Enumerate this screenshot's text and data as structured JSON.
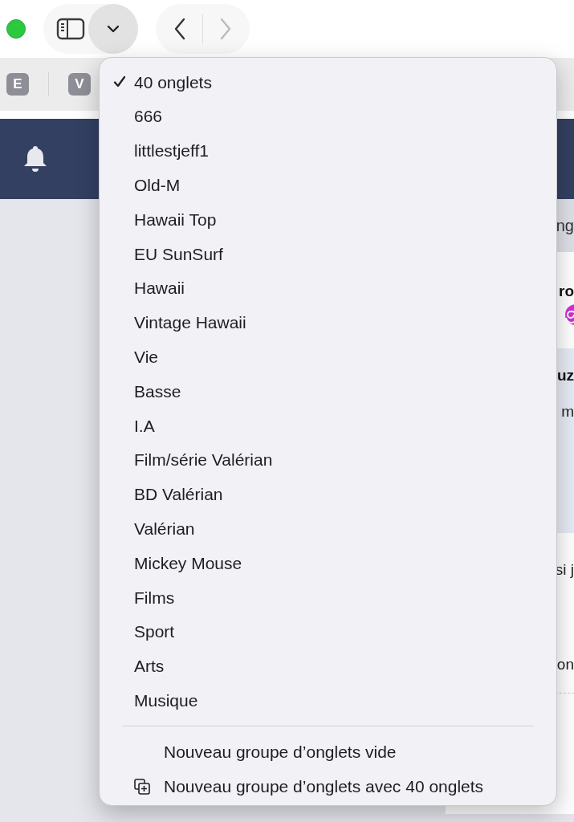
{
  "toolbar": {
    "sidebar_menu_open": true,
    "back_enabled": true,
    "forward_enabled": false
  },
  "favorites": [
    {
      "label": "E"
    },
    {
      "label": "V"
    }
  ],
  "background_fragments": [
    {
      "kind": "heading",
      "text": "ng"
    },
    {
      "kind": "bold",
      "text": "ro"
    },
    {
      "kind": "badge"
    },
    {
      "kind": "bold",
      "text": "uz"
    },
    {
      "kind": "plain",
      "text": "m"
    },
    {
      "kind": "plain",
      "text": "si j"
    },
    {
      "kind": "plain",
      "text": "on"
    }
  ],
  "menu": {
    "groups": [
      {
        "label": "40 onglets",
        "selected": true
      },
      {
        "label": "666",
        "selected": false
      },
      {
        "label": "littlestjeff1",
        "selected": false
      },
      {
        "label": "Old-M",
        "selected": false
      },
      {
        "label": "Hawaii Top",
        "selected": false
      },
      {
        "label": "EU SunSurf",
        "selected": false
      },
      {
        "label": "Hawaii",
        "selected": false
      },
      {
        "label": "Vintage Hawaii",
        "selected": false
      },
      {
        "label": "Vie",
        "selected": false
      },
      {
        "label": "Basse",
        "selected": false
      },
      {
        "label": "I.A",
        "selected": false
      },
      {
        "label": "Film/série Valérian",
        "selected": false
      },
      {
        "label": "BD Valérian",
        "selected": false
      },
      {
        "label": "Valérian",
        "selected": false
      },
      {
        "label": "Mickey Mouse",
        "selected": false
      },
      {
        "label": "Films",
        "selected": false
      },
      {
        "label": "Sport",
        "selected": false
      },
      {
        "label": "Arts",
        "selected": false
      },
      {
        "label": "Musique",
        "selected": false
      }
    ],
    "actions": [
      {
        "label": "Nouveau groupe d’onglets vide",
        "kind": "plain"
      },
      {
        "label": "Nouveau groupe d’onglets avec 40 onglets",
        "kind": "with-tabs"
      }
    ]
  }
}
